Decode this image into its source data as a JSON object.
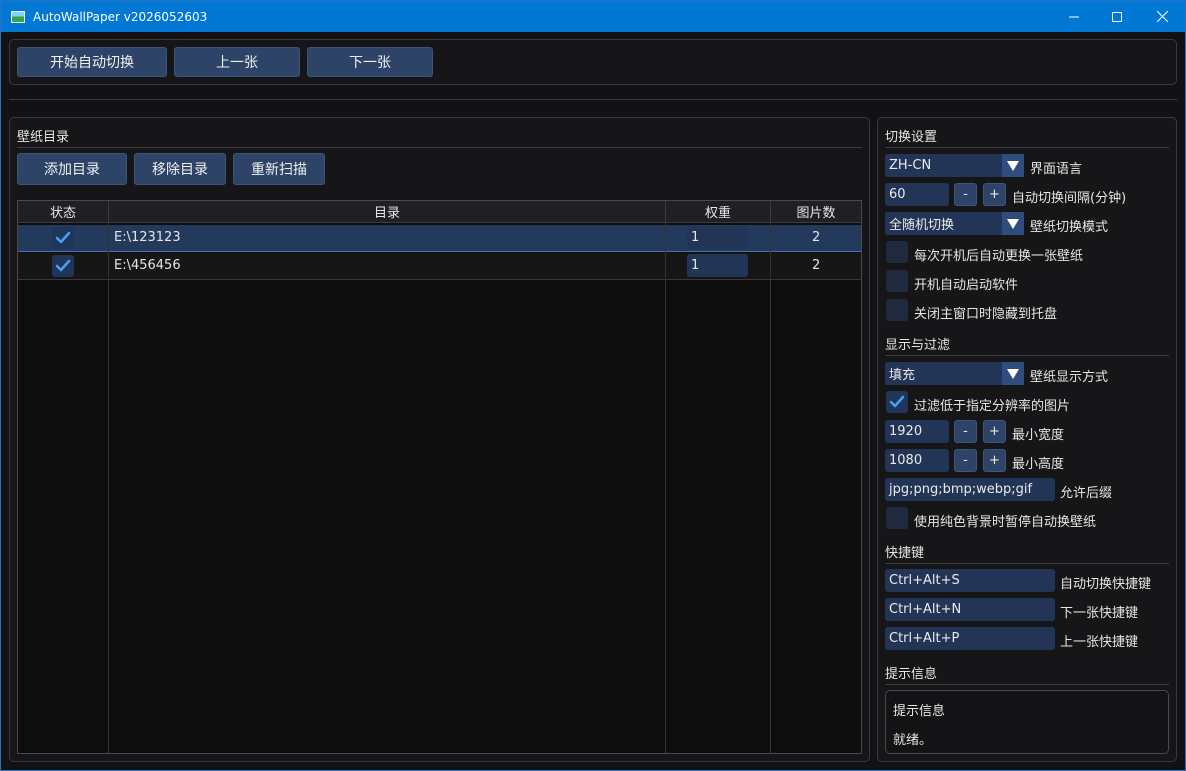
{
  "window": {
    "title": "AutoWallPaper v2026052603",
    "minimize_glyph": "—",
    "maximize_glyph": "☐",
    "close_glyph": "✕"
  },
  "toolbar": {
    "start_label": "开始自动切换",
    "prev_label": "上一张",
    "next_label": "下一张"
  },
  "directories": {
    "title": "壁纸目录",
    "add_label": "添加目录",
    "remove_label": "移除目录",
    "rescan_label": "重新扫描",
    "columns": [
      "状态",
      "目录",
      "权重",
      "图片数"
    ],
    "rows": [
      {
        "enabled": true,
        "path": "E:\\123123",
        "weight": "1",
        "count": "2"
      },
      {
        "enabled": true,
        "path": "E:\\456456",
        "weight": "1",
        "count": "2"
      }
    ]
  },
  "switch_settings": {
    "title": "切换设置",
    "language_value": "ZH-CN",
    "language_label": "界面语言",
    "interval_value": "60",
    "interval_label": "自动切换间隔(分钟)",
    "mode_value": "全随机切换",
    "mode_label": "壁纸切换模式",
    "change_on_boot_label": "每次开机后自动更换一张壁纸",
    "autostart_label": "开机自动启动软件",
    "hide_to_tray_label": "关闭主窗口时隐藏到托盘"
  },
  "display_filter": {
    "title": "显示与过滤",
    "display_value": "填充",
    "display_label": "壁纸显示方式",
    "filter_label": "过滤低于指定分辨率的图片",
    "min_width_value": "1920",
    "min_width_label": "最小宽度",
    "min_height_value": "1080",
    "min_height_label": "最小高度",
    "extensions_value": "jpg;png;bmp;webp;gif",
    "extensions_label": "允许后缀",
    "pause_solid_label": "使用纯色背景时暂停自动换壁纸"
  },
  "hotkeys": {
    "title": "快捷键",
    "auto_value": "Ctrl+Alt+S",
    "auto_label": "自动切换快捷键",
    "next_value": "Ctrl+Alt+N",
    "next_label": "下一张快捷键",
    "prev_value": "Ctrl+Alt+P",
    "prev_label": "上一张快捷键"
  },
  "info": {
    "title": "提示信息",
    "box_title": "提示信息",
    "message": "就绪。"
  },
  "stepper": {
    "minus": "-",
    "plus": "+"
  },
  "colors": {
    "titlebar": "#0078d4",
    "button": "#2d4468",
    "input": "#223556",
    "check_accent": "#4a9cf5"
  }
}
